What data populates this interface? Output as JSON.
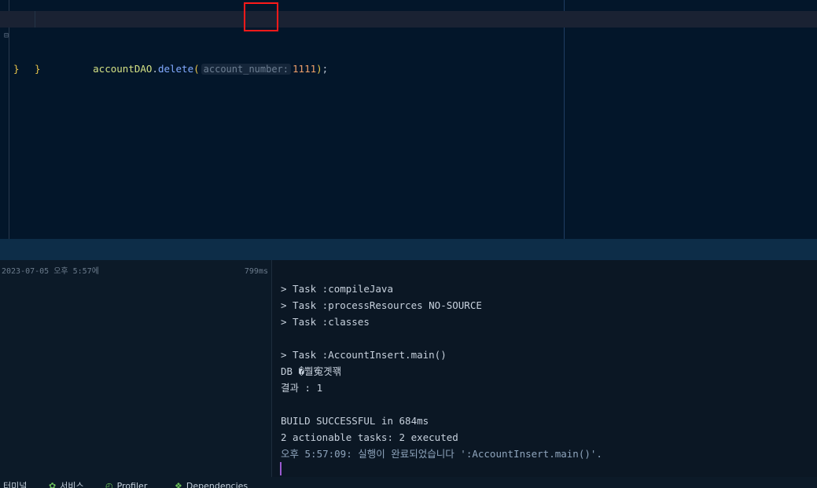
{
  "editor": {
    "call": {
      "object": "accountDAO",
      "dot": ".",
      "method": "delete",
      "open_paren": "(",
      "param_hint": "account_number:",
      "argument": "1111",
      "close_paren": ")",
      "semicolon": ";"
    },
    "method_close_brace": "}",
    "class_close_brace": "}"
  },
  "run_panel": {
    "run_entry": {
      "timestamp": "2023-07-05 오후 5:57에",
      "duration": "799ms"
    },
    "console_lines": [
      "> Task :compileJava",
      "> Task :processResources NO-SOURCE",
      "> Task :classes",
      "",
      "> Task :AccountInsert.main()",
      "DB �뿰寃곗꽦",
      "결과 : 1",
      "",
      "BUILD SUCCESSFUL in 684ms",
      "2 actionable tasks: 2 executed",
      "오후 5:57:09: 실행이 완료되었습니다 ':AccountInsert.main()'."
    ]
  },
  "tool_tabs": [
    {
      "label": "터미널",
      "icon": "terminal-icon",
      "glyph": ""
    },
    {
      "label": "서비스",
      "icon": "services-icon",
      "glyph": "✿"
    },
    {
      "label": "Profiler",
      "icon": "profiler-icon",
      "glyph": "◴"
    },
    {
      "label": "Dependencies",
      "icon": "dependencies-icon",
      "glyph": "❖"
    }
  ],
  "colors": {
    "editor_bg": "#03162a",
    "highlight_box": "#ff1a1a",
    "caret": "#9b59d0",
    "method": "#82aaff",
    "number": "#f0a06a"
  }
}
